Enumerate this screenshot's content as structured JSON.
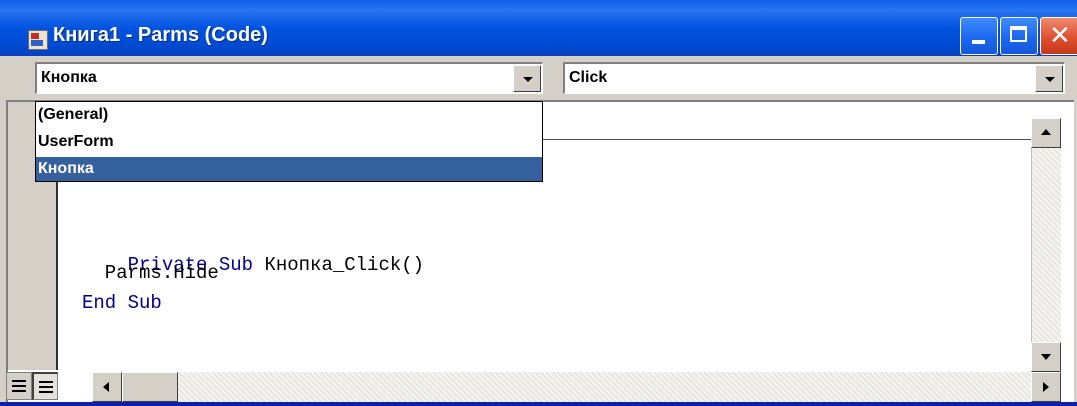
{
  "window": {
    "title": "Книга1 - Parms (Code)"
  },
  "title_buttons": {
    "minimize_icon": "minimize-icon",
    "maximize_icon": "maximize-icon",
    "close_icon": "close-icon",
    "close_glyph": "✕"
  },
  "object_combo": {
    "value": "Кнопка",
    "options": [
      "(General)",
      "UserForm",
      "Кнопка"
    ],
    "selected_index": 2
  },
  "procedure_combo": {
    "value": "Click"
  },
  "code": {
    "line1_kw1": "Private Sub ",
    "line1_name": "Кнопка_Click()",
    "line2": "  Parms.Hide",
    "line3": "End Sub"
  },
  "colors": {
    "titlebar": "#0053e0",
    "keyword": "#00008b",
    "selection": "#35609e",
    "close_button": "#dd4b2a"
  }
}
